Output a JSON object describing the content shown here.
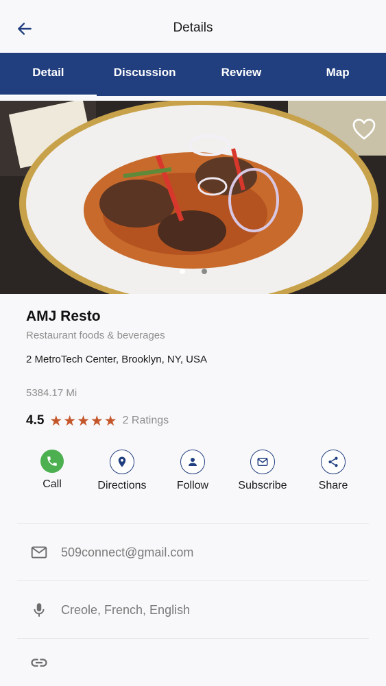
{
  "header": {
    "title": "Details"
  },
  "tabs": [
    {
      "label": "Detail",
      "active": true
    },
    {
      "label": "Discussion",
      "active": false
    },
    {
      "label": "Review",
      "active": false
    },
    {
      "label": "Map",
      "active": false
    }
  ],
  "gallery": {
    "image_count": 2,
    "current_index": 0
  },
  "business": {
    "name": "AMJ Resto",
    "category": "Restaurant foods & beverages",
    "address": "2 MetroTech Center, Brooklyn, NY, USA",
    "distance": "5384.17 Mi",
    "rating": "4.5",
    "stars": 5,
    "ratings_count": "2 Ratings"
  },
  "actions": [
    {
      "label": "Call",
      "icon": "phone-icon"
    },
    {
      "label": "Directions",
      "icon": "location-pin-icon"
    },
    {
      "label": "Follow",
      "icon": "person-icon"
    },
    {
      "label": "Subscribe",
      "icon": "mail-icon"
    },
    {
      "label": "Share",
      "icon": "share-icon"
    }
  ],
  "contact": {
    "email": "509connect@gmail.com",
    "languages": "Creole, French, English"
  },
  "colors": {
    "brand": "#213f7f",
    "call_green": "#4caf50",
    "star": "#c4562a"
  }
}
